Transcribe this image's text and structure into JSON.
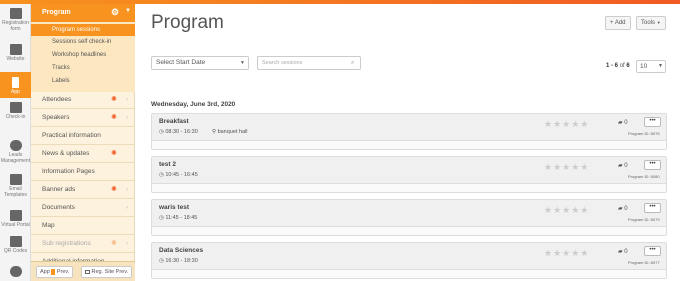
{
  "rail": [
    {
      "label": "Registration form",
      "icon": "clipboard-icon"
    },
    {
      "label": "Website",
      "icon": "monitor-icon"
    },
    {
      "label": "App",
      "icon": "phone-icon",
      "active": true
    },
    {
      "label": "Check-in",
      "icon": "ticket-icon"
    },
    {
      "label": "Leads Management",
      "icon": "user-icon"
    },
    {
      "label": "Email Templates",
      "icon": "envelope-icon"
    },
    {
      "label": "Virtual Portal",
      "icon": "video-icon"
    },
    {
      "label": "QR Codes",
      "icon": "qr-code-icon"
    },
    {
      "label": "",
      "icon": "settings-gear-icon"
    }
  ],
  "sidebar": {
    "header": "Program",
    "submenu": [
      "Program sessions",
      "Sessions self check-in",
      "Workshop headlines",
      "Tracks",
      "Labels"
    ],
    "menu": [
      {
        "label": "Attendees",
        "ind": "✺",
        "chev": "›"
      },
      {
        "label": "Speakers",
        "ind": "✺",
        "chev": "›"
      },
      {
        "label": "Practical information",
        "ind": "",
        "chev": ""
      },
      {
        "label": "News & updates",
        "ind": "✺",
        "chev": ""
      },
      {
        "label": "Information Pages",
        "ind": "",
        "chev": ""
      },
      {
        "label": "Banner ads",
        "ind": "✺",
        "chev": "›"
      },
      {
        "label": "Documents",
        "ind": "",
        "chev": "›"
      },
      {
        "label": "Map",
        "ind": "",
        "chev": ""
      },
      {
        "label": "Sub registrations",
        "ind": "✺",
        "chev": "›"
      },
      {
        "label": "Additional information",
        "ind": "",
        "chev": ""
      }
    ],
    "footer": {
      "app_prev": "App",
      "prev": "Prev.",
      "reg_site_prev": "Reg. Site Prev."
    }
  },
  "main": {
    "title": "Program",
    "add": "+ Add",
    "tools": "Tools",
    "date_placeholder": "Select Start Date",
    "search_placeholder": "Search sessions",
    "pager": {
      "range": "1 - 6",
      "of": "of",
      "total": "6"
    },
    "page_size": "10",
    "day": "Wednesday, June 3rd, 2020",
    "sessions": [
      {
        "name": "Breakfast",
        "time": "08:30 - 16:30",
        "location": "banquet hall",
        "comments": "0",
        "program_id": "Program ID: 8075"
      },
      {
        "name": "test 2",
        "time": "10:45 - 16:45",
        "location": "",
        "comments": "0",
        "program_id": "Program ID: 8080"
      },
      {
        "name": "waris test",
        "time": "11:45 - 18:45",
        "location": "",
        "comments": "0",
        "program_id": "Program ID: 8079"
      },
      {
        "name": "Data Sciences",
        "time": "16:30 - 18:30",
        "location": "",
        "comments": "0",
        "program_id": "Program ID: 8077"
      }
    ]
  }
}
